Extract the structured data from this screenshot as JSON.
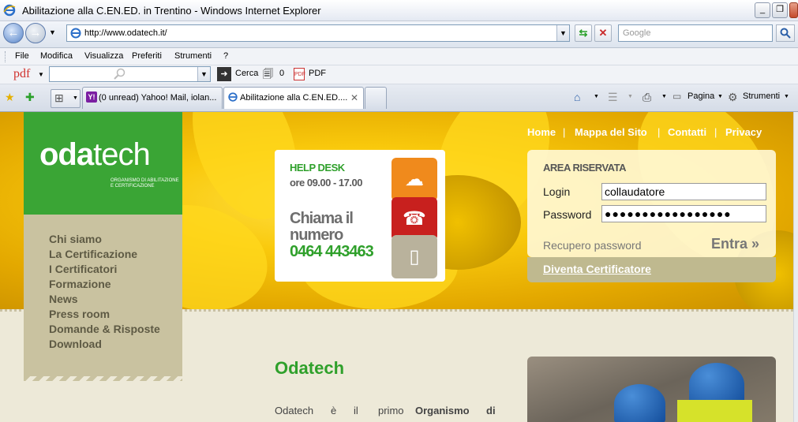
{
  "window": {
    "title": "Abilitazione alla C.EN.ED. in Trentino - Windows Internet Explorer",
    "controls": [
      "_",
      "❐",
      "X"
    ]
  },
  "addressbar": {
    "url": "http://www.odatech.it/",
    "search_placeholder": "Google"
  },
  "menubar": {
    "items": [
      "File",
      "Modifica",
      "Visualizza",
      "Preferiti",
      "Strumenti",
      "?"
    ]
  },
  "pdftoolbar": {
    "logo": "pdf",
    "cerca": "Cerca",
    "count": "0",
    "pdf": "PDF"
  },
  "tabs": [
    {
      "label": "(0 unread) Yahoo! Mail, iolan...",
      "icon": "yahoo-icon",
      "active": false
    },
    {
      "label": "Abilitazione alla C.EN.ED....",
      "icon": "ie-icon",
      "active": true
    }
  ],
  "commandbar": {
    "pagina": "Pagina",
    "strumenti": "Strumenti"
  },
  "site": {
    "logo": {
      "bold": "oda",
      "light": "tech",
      "tagline": "ORGANISMO DI ABILITAZIONE E CERTIFICAZIONE"
    },
    "nav": [
      "Chi siamo",
      "La Certificazione",
      "I Certificatori",
      "Formazione",
      "News",
      "Press room",
      "Domande & Risposte",
      "Download"
    ],
    "topnav": [
      "Home",
      "Mappa del Sito",
      "Contatti",
      "Privacy"
    ],
    "helpdesk": {
      "title": "HELP DESK",
      "hours": "ore 09.00 - 17.00",
      "call": "Chiama il numero",
      "number": "0464 443463"
    },
    "area": {
      "title": "AREA RISERVATA",
      "login_label": "Login",
      "login_value": "collaudatore",
      "password_label": "Password",
      "password_value": "●●●●●●●●●●●●●●●●●",
      "recupero": "Recupero password",
      "entra": "Entra »",
      "diventa": "Diventa Certificatore"
    },
    "content": {
      "heading": "Odatech",
      "intro_words": [
        "Odatech",
        "è",
        "il",
        "primo",
        "Organismo",
        "di"
      ]
    }
  },
  "colors": {
    "brand_green": "#3aa535",
    "panel": "#c9c2a0",
    "hero_yellow": "#f9c90c"
  }
}
